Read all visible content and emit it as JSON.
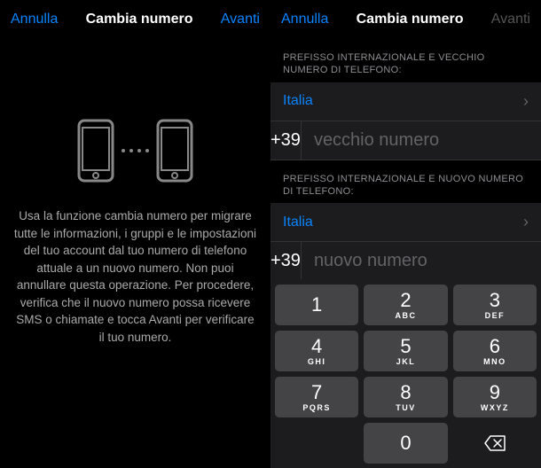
{
  "left": {
    "nav": {
      "cancel": "Annulla",
      "title": "Cambia numero",
      "next": "Avanti"
    },
    "info": "Usa la funzione cambia numero per migrare tutte le informazioni, i gruppi e le impostazioni del tuo account dal tuo numero di telefono attuale a un nuovo numero. Non puoi annullare questa operazione. Per procedere, verifica che il nuovo numero possa ricevere SMS o chiamate e tocca Avanti per verificare il tuo numero."
  },
  "right": {
    "nav": {
      "cancel": "Annulla",
      "title": "Cambia numero",
      "next": "Avanti"
    },
    "sections": {
      "old": {
        "header": "PREFISSO INTERNAZIONALE E VECCHIO NUMERO DI TELEFONO:",
        "country": "Italia",
        "prefix": "+39",
        "placeholder": "vecchio numero"
      },
      "new": {
        "header": "PREFISSO INTERNAZIONALE E NUOVO NUMERO DI TELEFONO:",
        "country": "Italia",
        "prefix": "+39",
        "placeholder": "nuovo numero"
      }
    },
    "keypad": [
      {
        "d": "1",
        "l": ""
      },
      {
        "d": "2",
        "l": "ABC"
      },
      {
        "d": "3",
        "l": "DEF"
      },
      {
        "d": "4",
        "l": "GHI"
      },
      {
        "d": "5",
        "l": "JKL"
      },
      {
        "d": "6",
        "l": "MNO"
      },
      {
        "d": "7",
        "l": "PQRS"
      },
      {
        "d": "8",
        "l": "TUV"
      },
      {
        "d": "9",
        "l": "WXYZ"
      },
      {
        "d": "",
        "l": ""
      },
      {
        "d": "0",
        "l": ""
      },
      {
        "d": "",
        "l": ""
      }
    ]
  }
}
